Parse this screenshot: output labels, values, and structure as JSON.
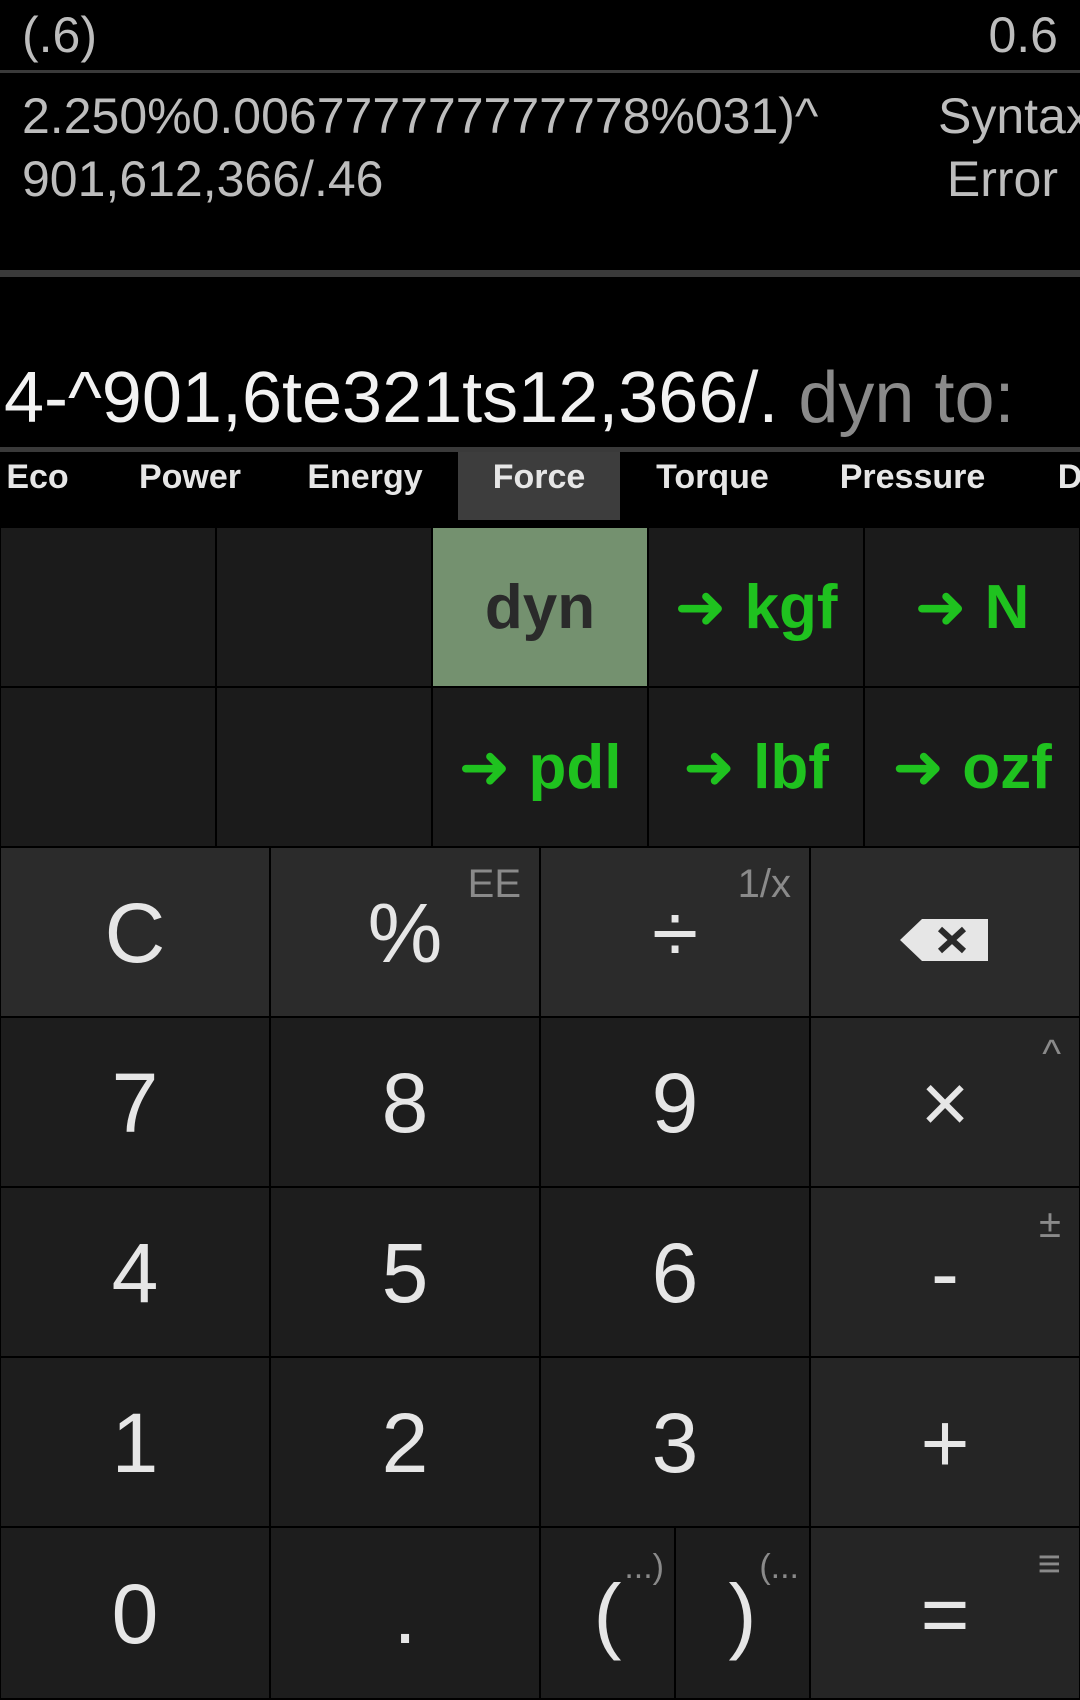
{
  "history": [
    {
      "expression": "(.6)",
      "result": "0.6"
    },
    {
      "expression": "2.250%0.006777777777778%031)^901,612,366/.46",
      "result": "Syntax Error"
    }
  ],
  "input": {
    "value": "4-^901,6te321ts12,366/.",
    "suffix": "dyn to:"
  },
  "tabs": [
    {
      "label": "Eco"
    },
    {
      "label": "Power"
    },
    {
      "label": "Energy"
    },
    {
      "label": "Force",
      "active": true
    },
    {
      "label": "Torque"
    },
    {
      "label": "Pressure"
    },
    {
      "label": "D"
    }
  ],
  "units": {
    "selected": "dyn",
    "arrow": "➜",
    "targets": [
      "kgf",
      "N",
      "pdl",
      "lbf",
      "ozf"
    ]
  },
  "keys": {
    "clear": "C",
    "percent": "%",
    "percent_alt": "EE",
    "divide": "÷",
    "divide_alt": "1/x",
    "backspace": "⌫",
    "seven": "7",
    "eight": "8",
    "nine": "9",
    "multiply": "×",
    "multiply_alt": "^",
    "four": "4",
    "five": "5",
    "six": "6",
    "minus": "-",
    "minus_alt": "±",
    "one": "1",
    "two": "2",
    "three": "3",
    "plus": "+",
    "zero": "0",
    "decimal": ".",
    "open_paren": "(",
    "open_paren_alt": "...)",
    "close_paren": ")",
    "close_paren_alt": "(...",
    "equals": "=",
    "equals_alt": "≡"
  },
  "colors": {
    "accent_green": "#1fc21f",
    "selected_unit_bg": "#74916f"
  }
}
